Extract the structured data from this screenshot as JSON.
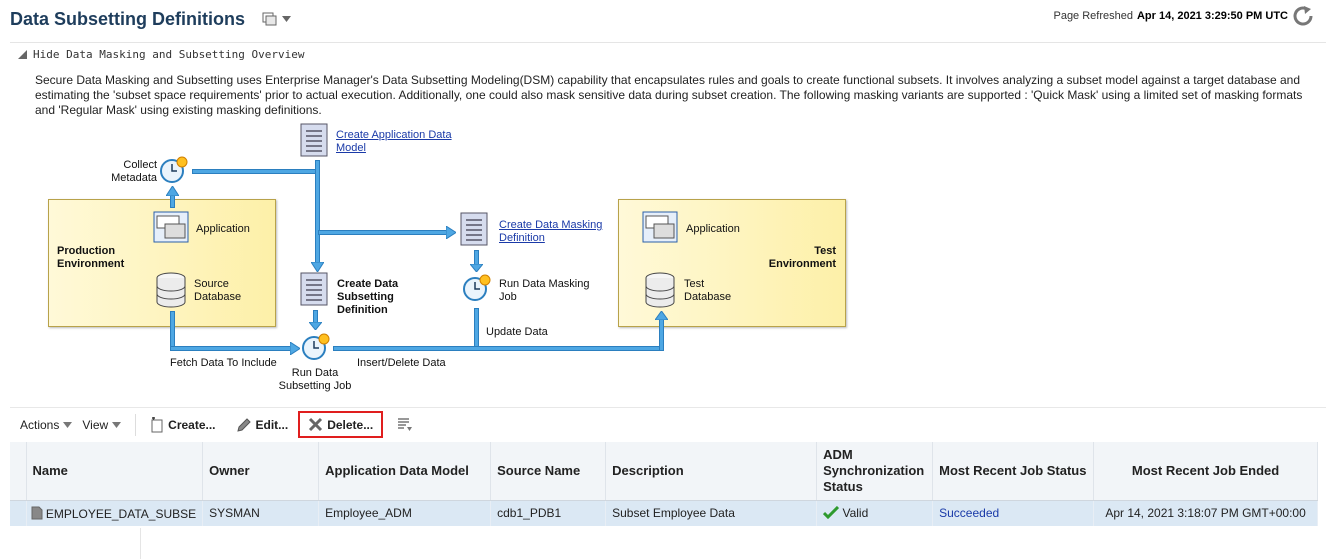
{
  "header": {
    "title": "Data Subsetting Definitions",
    "refresh_label": "Page Refreshed",
    "refresh_time": "Apr 14, 2021 3:29:50 PM UTC"
  },
  "overview": {
    "toggle_label": "Hide Data Masking and Subsetting Overview",
    "text": "Secure Data Masking and Subsetting uses Enterprise Manager's Data Subsetting Modeling(DSM) capability that encapsulates rules and goals to create functional subsets. It involves analyzing a subset model against a target database and estimating the 'subset space requirements' prior to actual execution. Additionally, one could also mask sensitive data during subset creation. The following masking variants are supported : 'Quick Mask' using a limited set of masking formats and 'Regular Mask' using existing masking definitions."
  },
  "diagram": {
    "collect_metadata_1": "Collect",
    "collect_metadata_2": "Metadata",
    "create_adm_1": "Create Application Data",
    "create_adm_2": "Model",
    "prod_env_1": "Production",
    "prod_env_2": "Environment",
    "prod_app": "Application",
    "prod_db_1": "Source",
    "prod_db_2": "Database",
    "create_masking_1": "Create Data Masking",
    "create_masking_2": "Definition",
    "create_subset_1": "Create Data",
    "create_subset_2": "Subsetting",
    "create_subset_3": "Definition",
    "run_masking_1": "Run Data Masking",
    "run_masking_2": "Job",
    "update_data": "Update Data",
    "fetch_data": "Fetch Data To Include",
    "run_subset_1": "Run Data",
    "run_subset_2": "Subsetting Job",
    "insert_delete": "Insert/Delete Data",
    "test_app": "Application",
    "test_env_1": "Test",
    "test_env_2": "Environment",
    "test_db_1": "Test",
    "test_db_2": "Database"
  },
  "toolbar": {
    "actions": "Actions",
    "view": "View",
    "create": "Create...",
    "edit": "Edit...",
    "delete": "Delete..."
  },
  "table": {
    "headers": {
      "name": "Name",
      "owner": "Owner",
      "adm": "Application Data Model",
      "source": "Source Name",
      "description": "Description",
      "adm_sync_1": "ADM",
      "adm_sync_2": "Synchronization",
      "adm_sync_3": "Status",
      "job_status": "Most Recent Job Status",
      "job_ended": "Most Recent Job Ended"
    },
    "rows": [
      {
        "name": "EMPLOYEE_DATA_SUBSE",
        "owner": "SYSMAN",
        "adm": "Employee_ADM",
        "source": "cdb1_PDB1",
        "description": "Subset Employee Data",
        "sync": "Valid",
        "job_status": "Succeeded",
        "job_ended": "Apr 14, 2021 3:18:07 PM GMT+00:00"
      }
    ]
  },
  "colors": {
    "title": "#1e3d5c",
    "link": "#1a3aa8",
    "arrow": "#4ea7e3",
    "delete_highlight": "#e01e1e",
    "selected_row": "#dbe8f4",
    "valid_check": "#2e9a2e"
  }
}
